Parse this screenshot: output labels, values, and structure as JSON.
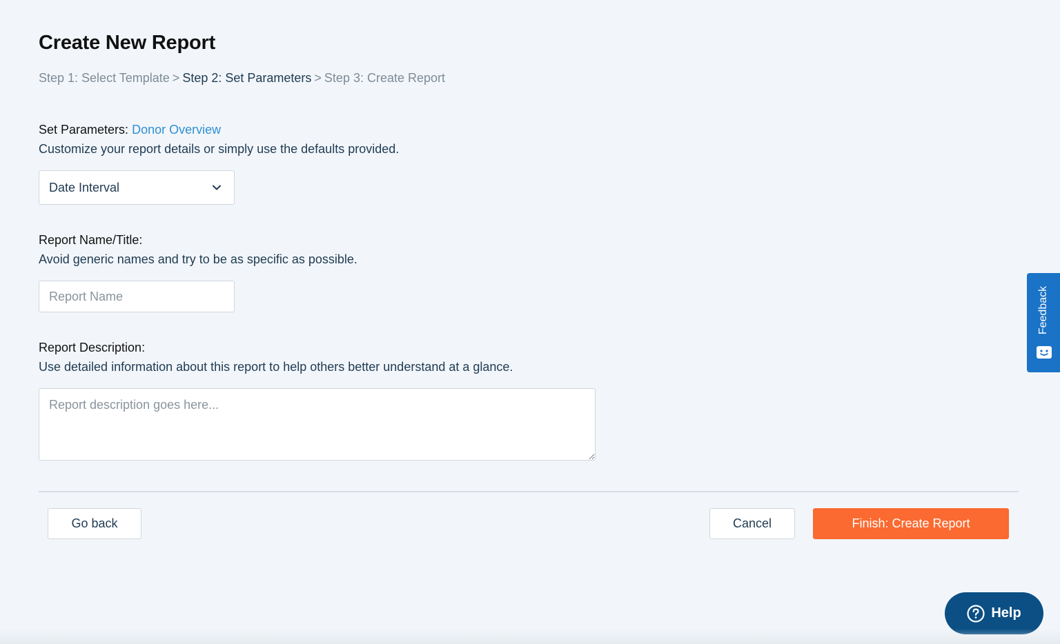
{
  "page": {
    "title": "Create New Report"
  },
  "breadcrumb": {
    "steps": [
      {
        "label": "Step 1: Select Template",
        "state": "inactive"
      },
      {
        "label": "Step 2: Set Parameters",
        "state": "current"
      },
      {
        "label": "Step 3: Create Report",
        "state": "inactive"
      }
    ],
    "separator": ">"
  },
  "parameters": {
    "label": "Set Parameters:",
    "template_name": "Donor Overview",
    "help": "Customize your report details or simply use the defaults provided.",
    "date_select": {
      "selected": "Date Interval",
      "icon": "chevron-down-icon"
    }
  },
  "report_name": {
    "label": "Report Name/Title:",
    "help": "Avoid generic names and try to be as specific as possible.",
    "value": "",
    "placeholder": "Report Name"
  },
  "report_description": {
    "label": "Report Description:",
    "help": "Use detailed information about this report to help others better understand at a glance.",
    "value": "",
    "placeholder": "Report description goes here..."
  },
  "actions": {
    "back_label": "Go back",
    "cancel_label": "Cancel",
    "finish_label": "Finish: Create Report"
  },
  "feedback": {
    "label": "Feedback",
    "icon": "feedback-face-icon"
  },
  "help": {
    "label": "Help",
    "icon": "question-circle-icon"
  },
  "colors": {
    "background": "#f2f6fa",
    "primary_accent": "#fb6a30",
    "link": "#2f8fd3",
    "feedback_tab": "#1a73c7",
    "help_button": "#0b4f84",
    "text": "#1f3a52"
  }
}
